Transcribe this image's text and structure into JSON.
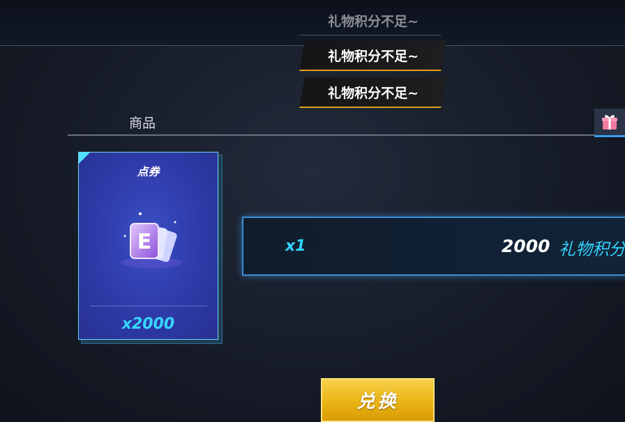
{
  "toasts": {
    "top_faded": "礼物积分不足~",
    "middle": "礼物积分不足~",
    "bottom": "礼物积分不足~"
  },
  "tab": {
    "label": "商品",
    "gift_icon": "gift-icon"
  },
  "item": {
    "name": "点券",
    "quantity": "x2000",
    "icon": "ticket-icon"
  },
  "price": {
    "qty": "x1",
    "amount": "2000",
    "currency": "礼物积分"
  },
  "actions": {
    "exchange_label": "兑换"
  },
  "colors": {
    "accent": "#31d4ff",
    "button": "#e9b212",
    "warning_line": "#e0a21a"
  }
}
